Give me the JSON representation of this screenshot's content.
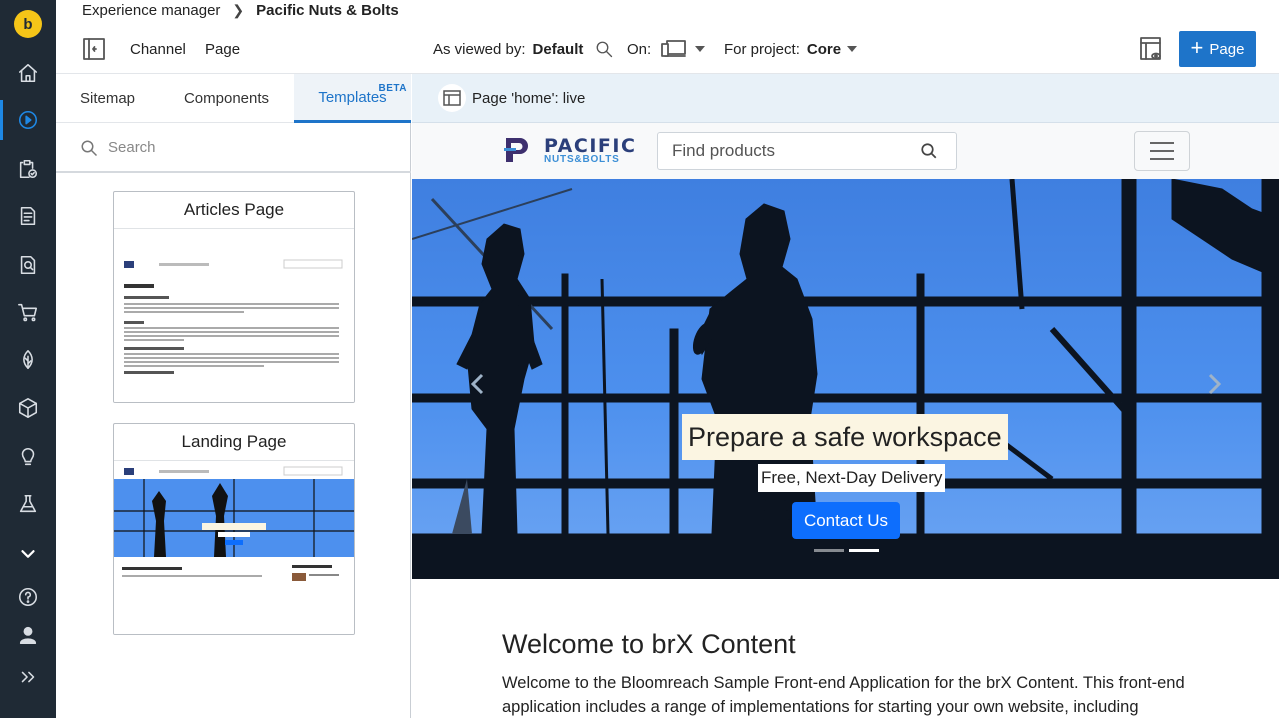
{
  "breadcrumb": {
    "root": "Experience manager",
    "current": "Pacific Nuts & Bolts"
  },
  "toolbar": {
    "channel": "Channel",
    "page": "Page",
    "viewed_by_label": "As viewed by:",
    "viewed_by_value": "Default",
    "on_label": "On:",
    "project_label": "For project:",
    "project_value": "Core",
    "add_page_label": "Page"
  },
  "logo_letter": "b",
  "panel": {
    "tabs": [
      {
        "label": "Sitemap"
      },
      {
        "label": "Components"
      },
      {
        "label": "Templates",
        "active": true,
        "badge": "BETA"
      }
    ],
    "search_placeholder": "Search",
    "templates": [
      {
        "title": "Articles Page"
      },
      {
        "title": "Landing Page"
      }
    ]
  },
  "preview": {
    "live_label": "Page 'home': live",
    "brand_name": "PACIFIC",
    "brand_sub": "NUTS&BOLTS",
    "find_placeholder": "Find products",
    "hero_title": "Prepare a safe workspace",
    "hero_sub": "Free, Next-Day Delivery",
    "hero_button": "Contact Us",
    "welcome_title": "Welcome to brX Content",
    "welcome_body": "Welcome to the Bloomreach Sample Front-end Application for the brX Content. This front-end application includes a range of implementations for starting your own website, including"
  },
  "colors": {
    "nav_bg": "#1f2a35",
    "accent": "#1e74c9",
    "logo": "#f5c518",
    "hero_sky": "#4d90ee"
  }
}
